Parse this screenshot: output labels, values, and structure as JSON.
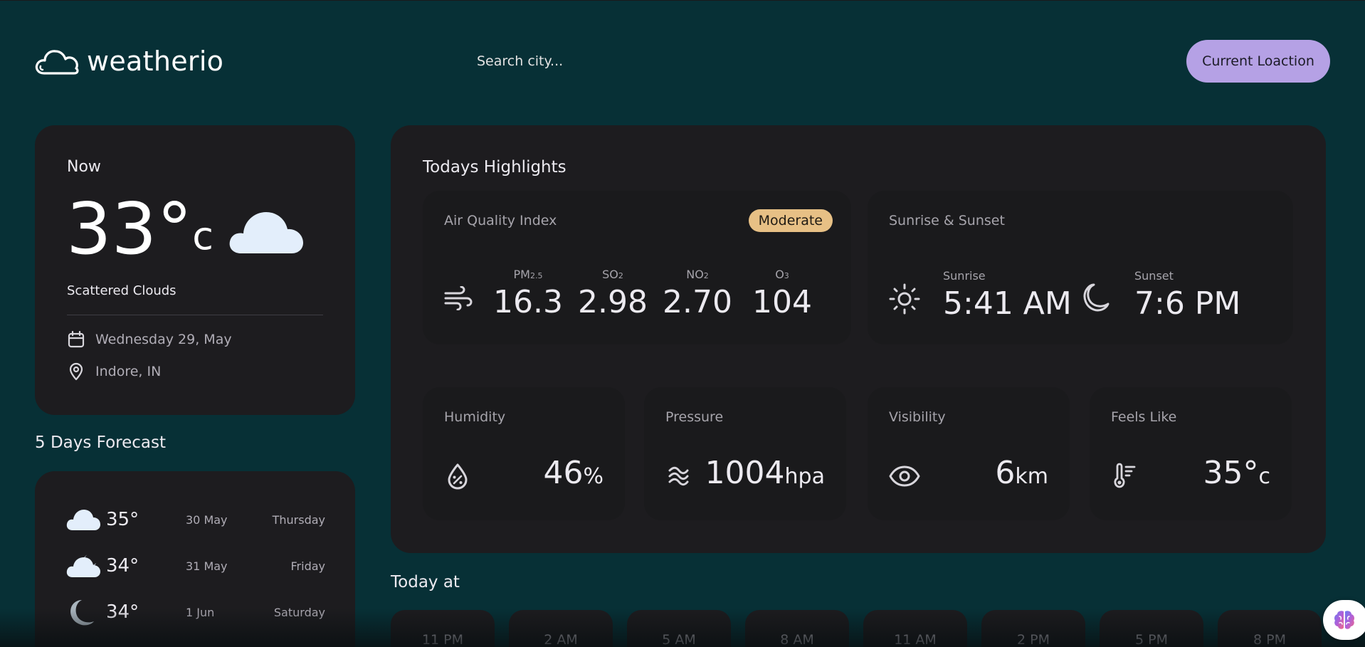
{
  "header": {
    "logo_text": "weatherio",
    "search_placeholder": "Search city...",
    "location_button": "Current Loaction"
  },
  "current": {
    "title": "Now",
    "temperature": "33°",
    "unit": "c",
    "description": "Scattered Clouds",
    "date": "Wednesday 29, May",
    "location": "Indore, IN"
  },
  "forecast": {
    "title": "5 Days Forecast",
    "days": [
      {
        "icon": "cloud-icon",
        "temp": "35°",
        "date": "30 May",
        "day": "Thursday"
      },
      {
        "icon": "moon-cloud-icon",
        "temp": "34°",
        "date": "31 May",
        "day": "Friday"
      },
      {
        "icon": "moon-icon",
        "temp": "34°",
        "date": "1 Jun",
        "day": "Saturday"
      }
    ]
  },
  "highlights": {
    "title": "Todays Highlights",
    "air_quality": {
      "label": "Air Quality Index",
      "badge": "Moderate",
      "pollutants": [
        {
          "name": "PM",
          "sub": "2.5",
          "value": "16.3"
        },
        {
          "name": "SO",
          "sub": "2",
          "value": "2.98"
        },
        {
          "name": "NO",
          "sub": "2",
          "value": "2.70"
        },
        {
          "name": "O",
          "sub": "3",
          "value": "104"
        }
      ]
    },
    "sun": {
      "label": "Sunrise & Sunset",
      "sunrise_label": "Sunrise",
      "sunrise": "5:41 AM",
      "sunset_label": "Sunset",
      "sunset": "7:6 PM"
    },
    "humidity": {
      "label": "Humidity",
      "value": "46",
      "unit": "%"
    },
    "pressure": {
      "label": "Pressure",
      "value": "1004",
      "unit": "hpa"
    },
    "visibility": {
      "label": "Visibility",
      "value": "6",
      "unit": "km"
    },
    "feels_like": {
      "label": "Feels Like",
      "value": "35°",
      "unit": "c"
    }
  },
  "today": {
    "title": "Today at",
    "hours": [
      "11 PM",
      "2 AM",
      "5 AM",
      "8 AM",
      "11 AM",
      "2 PM",
      "5 PM",
      "8 PM"
    ]
  },
  "colors": {
    "background": "#073036",
    "card": "#1d1c1f",
    "accent": "#b5a1e5",
    "badge": "#e7c085"
  }
}
